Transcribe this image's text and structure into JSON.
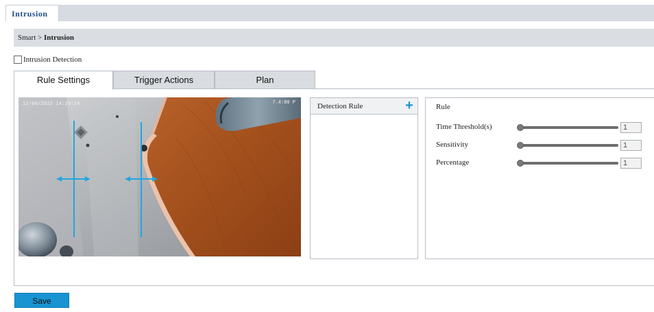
{
  "top_tab": {
    "label": "Intrusion"
  },
  "breadcrumb": {
    "parent": "Smart",
    "separator": ">",
    "current": "Intrusion"
  },
  "enable": {
    "label": "Intrusion Detection",
    "checked": false
  },
  "subtabs": [
    {
      "label": "Rule Settings",
      "active": true
    },
    {
      "label": "Trigger Actions",
      "active": false
    },
    {
      "label": "Plan",
      "active": false
    }
  ],
  "video": {
    "timestamp": "12/06/2022 14:29:24",
    "osd_right": "7.4:00 P"
  },
  "rule_list": {
    "header": "Detection Rule",
    "add_icon": "plus-icon"
  },
  "rule": {
    "title": "Rule",
    "params": [
      {
        "label": "Time Threshold(s)",
        "value": "1"
      },
      {
        "label": "Sensitivity",
        "value": "1"
      },
      {
        "label": "Percentage",
        "value": "1"
      }
    ]
  },
  "save_label": "Save",
  "colors": {
    "accent": "#1894d3",
    "tab_text": "#1d4f86",
    "rule_line": "#21a6e0"
  }
}
